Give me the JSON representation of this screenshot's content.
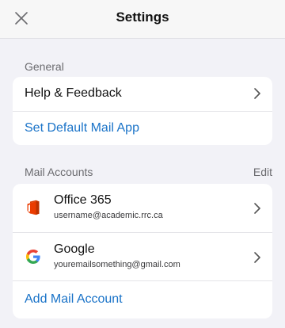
{
  "header": {
    "title": "Settings",
    "close_icon": "close-icon"
  },
  "general": {
    "section_label": "General",
    "items": [
      {
        "label": "Help & Feedback",
        "icon": "chevron-right-icon"
      },
      {
        "label": "Set Default Mail App"
      }
    ]
  },
  "mail_accounts": {
    "section_label": "Mail Accounts",
    "edit_label": "Edit",
    "accounts": [
      {
        "name": "Office 365",
        "email": "username@academic.rrc.ca",
        "icon": "office365-icon"
      },
      {
        "name": "Google",
        "email": "youremailsomething@gmail.com",
        "icon": "google-icon"
      }
    ],
    "add_label": "Add Mail Account"
  },
  "colors": {
    "background": "#f2f2f7",
    "card": "#ffffff",
    "link": "#1a73c8",
    "secondary_text": "#6b6b6f",
    "office_red": "#d83b01",
    "google_blue": "#4285f4",
    "google_red": "#ea4335",
    "google_yellow": "#fbbc05",
    "google_green": "#34a853"
  }
}
